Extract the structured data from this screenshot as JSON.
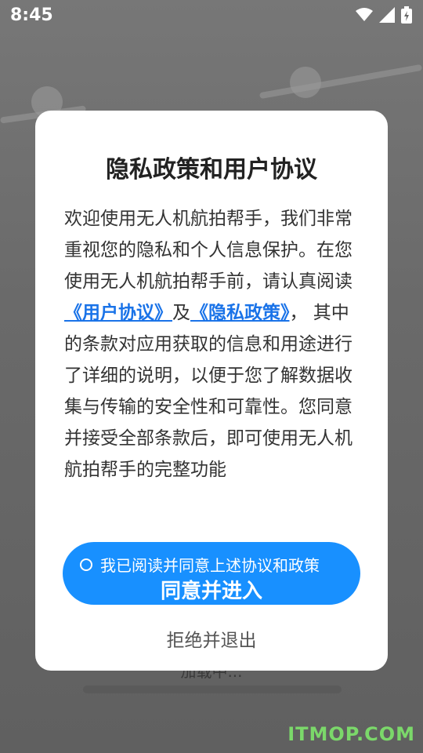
{
  "status_bar": {
    "time": "8:45",
    "icons": [
      "wifi-icon",
      "cell-signal-icon",
      "battery-charging-icon"
    ]
  },
  "background": {
    "loading_text": "加载中..."
  },
  "dialog": {
    "title": "隐私政策和用户协议",
    "body_part1": "欢迎使用无人机航拍帮手，我们非常重视您的隐私和个人信息保护。在您使用无人机航拍帮手前，请认真阅读",
    "link_user_agreement": "《用户协议》",
    "conjunction": "及",
    "link_privacy_policy": "《隐私政策》",
    "body_part2": "， 其中的条款对应用获取的信息和用途进行了详细的说明，以便于您了解数据收集与传输的安全性和可靠性。您同意并接受全部条款后，即可使用无人机航拍帮手的完整功能",
    "checkbox_label": "我已阅读并同意上述协议和政策",
    "agree_button": "同意并进入",
    "reject_button": "拒绝并退出"
  },
  "watermark": "ITMOP.COM",
  "colors": {
    "accent": "#1890ff",
    "link": "#1a73e8",
    "watermark": "#7bd86a"
  }
}
